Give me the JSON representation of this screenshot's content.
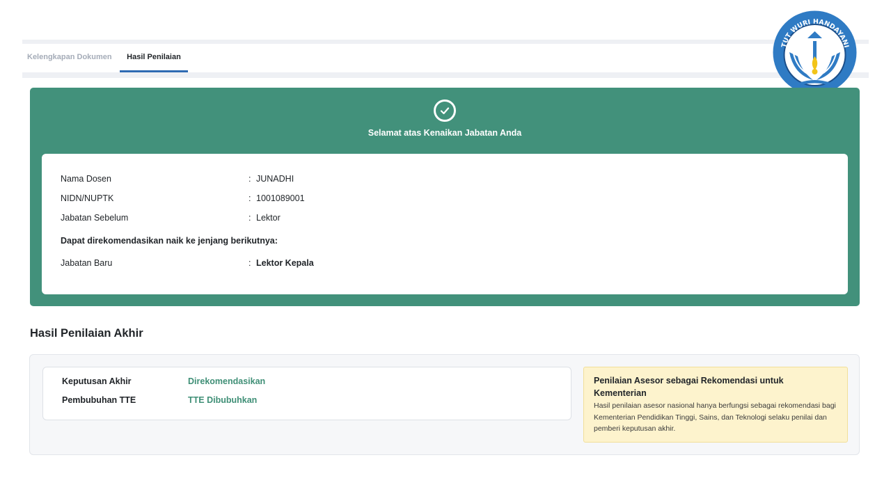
{
  "tabs": [
    {
      "label": "Kelengkapan Dokumen"
    },
    {
      "label": "Hasil Penilaian"
    }
  ],
  "logo": {
    "motto": "TUT WURI HANDAYANI",
    "colors": {
      "ring": "#2f7bc4",
      "gold": "#f2c418"
    }
  },
  "success": {
    "title": "Selamat atas Kenaikan Jabatan Anda",
    "color": "#42917b"
  },
  "info": {
    "nama_label": "Nama Dosen",
    "nama_value": "JUNADHI",
    "nidn_label": "NIDN/NUPTK",
    "nidn_value": "1001089001",
    "jabatan_sebelum_label": "Jabatan Sebelum",
    "jabatan_sebelum_value": "Lektor",
    "recommend_heading": "Dapat direkomendasikan naik ke jenjang berikutnya:",
    "jabatan_baru_label": "Jabatan Baru",
    "jabatan_baru_value": "Lektor Kepala",
    "separator": ":"
  },
  "result": {
    "section_title": "Hasil Penilaian Akhir",
    "keputusan_label": "Keputusan Akhir",
    "keputusan_value": "Direkomendasikan",
    "tte_label": "Pembubuhan TTE",
    "tte_value": "TTE Dibubuhkan",
    "value_color": "#3f8f76"
  },
  "note": {
    "title": "Penilaian Asesor sebagai Rekomendasi untuk Kementerian",
    "text": "Hasil penilaian asesor nasional hanya berfungsi sebagai rekomendasi bagi Kementerian Pendidikan Tinggi, Sains, dan Teknologi selaku penilai dan pemberi keputusan akhir."
  }
}
